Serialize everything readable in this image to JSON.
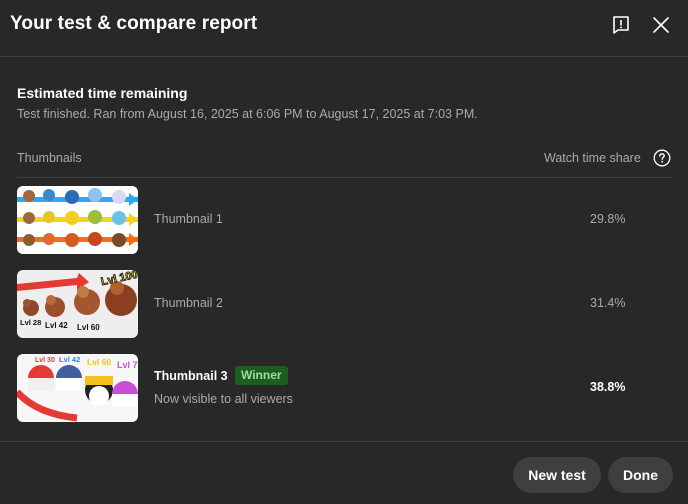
{
  "dialog": {
    "title": "Your test & compare report",
    "feedback_icon": "feedback-icon",
    "close_icon": "close-icon"
  },
  "summary": {
    "heading": "Estimated time remaining",
    "details": "Test finished. Ran from August 16, 2025 at 6:06 PM to August 17, 2025 at 7:03 PM."
  },
  "table": {
    "col_left": "Thumbnails",
    "col_right": "Watch time share",
    "help_icon": "help-circle-icon",
    "rows": [
      {
        "label": "Thumbnail 1",
        "share": "29.8%"
      },
      {
        "label": "Thumbnail 2",
        "share": "31.4%"
      },
      {
        "label": "Thumbnail 3",
        "share": "38.8%",
        "badge": "Winner",
        "note": "Now visible to all viewers"
      }
    ],
    "thumb2_text": {
      "lvl_a": "Lvl 28",
      "lvl_b": "Lvl 42",
      "lvl_c": "Lvl 60",
      "lvl_d": "Lvl 100"
    },
    "thumb3_text": {
      "lvl_a": "Lvl 30",
      "lvl_b": "Lvl 42",
      "lvl_c": "Lvl 60",
      "lvl_d": "Lvl 7"
    }
  },
  "colors": {
    "background": "#282828",
    "winner_bg": "#1b5e20",
    "winner_text": "#a5d6a7"
  },
  "footer": {
    "new_test_label": "New test",
    "done_label": "Done"
  }
}
